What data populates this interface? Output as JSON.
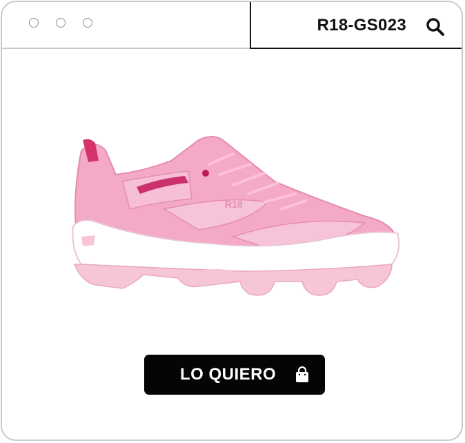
{
  "window": {
    "controls": [
      "window-dot-1",
      "window-dot-2",
      "window-dot-3"
    ]
  },
  "search": {
    "query": "R18-GS023",
    "icon": "search-icon"
  },
  "product": {
    "image_alt": "pink sneaker",
    "brand_mark": "R18",
    "colors": {
      "upper": "#f2a6c4",
      "sole": "#ffffff",
      "accent": "#c2185b"
    }
  },
  "cta": {
    "label": "LO QUIERO",
    "icon": "shopping-bag-icon"
  }
}
